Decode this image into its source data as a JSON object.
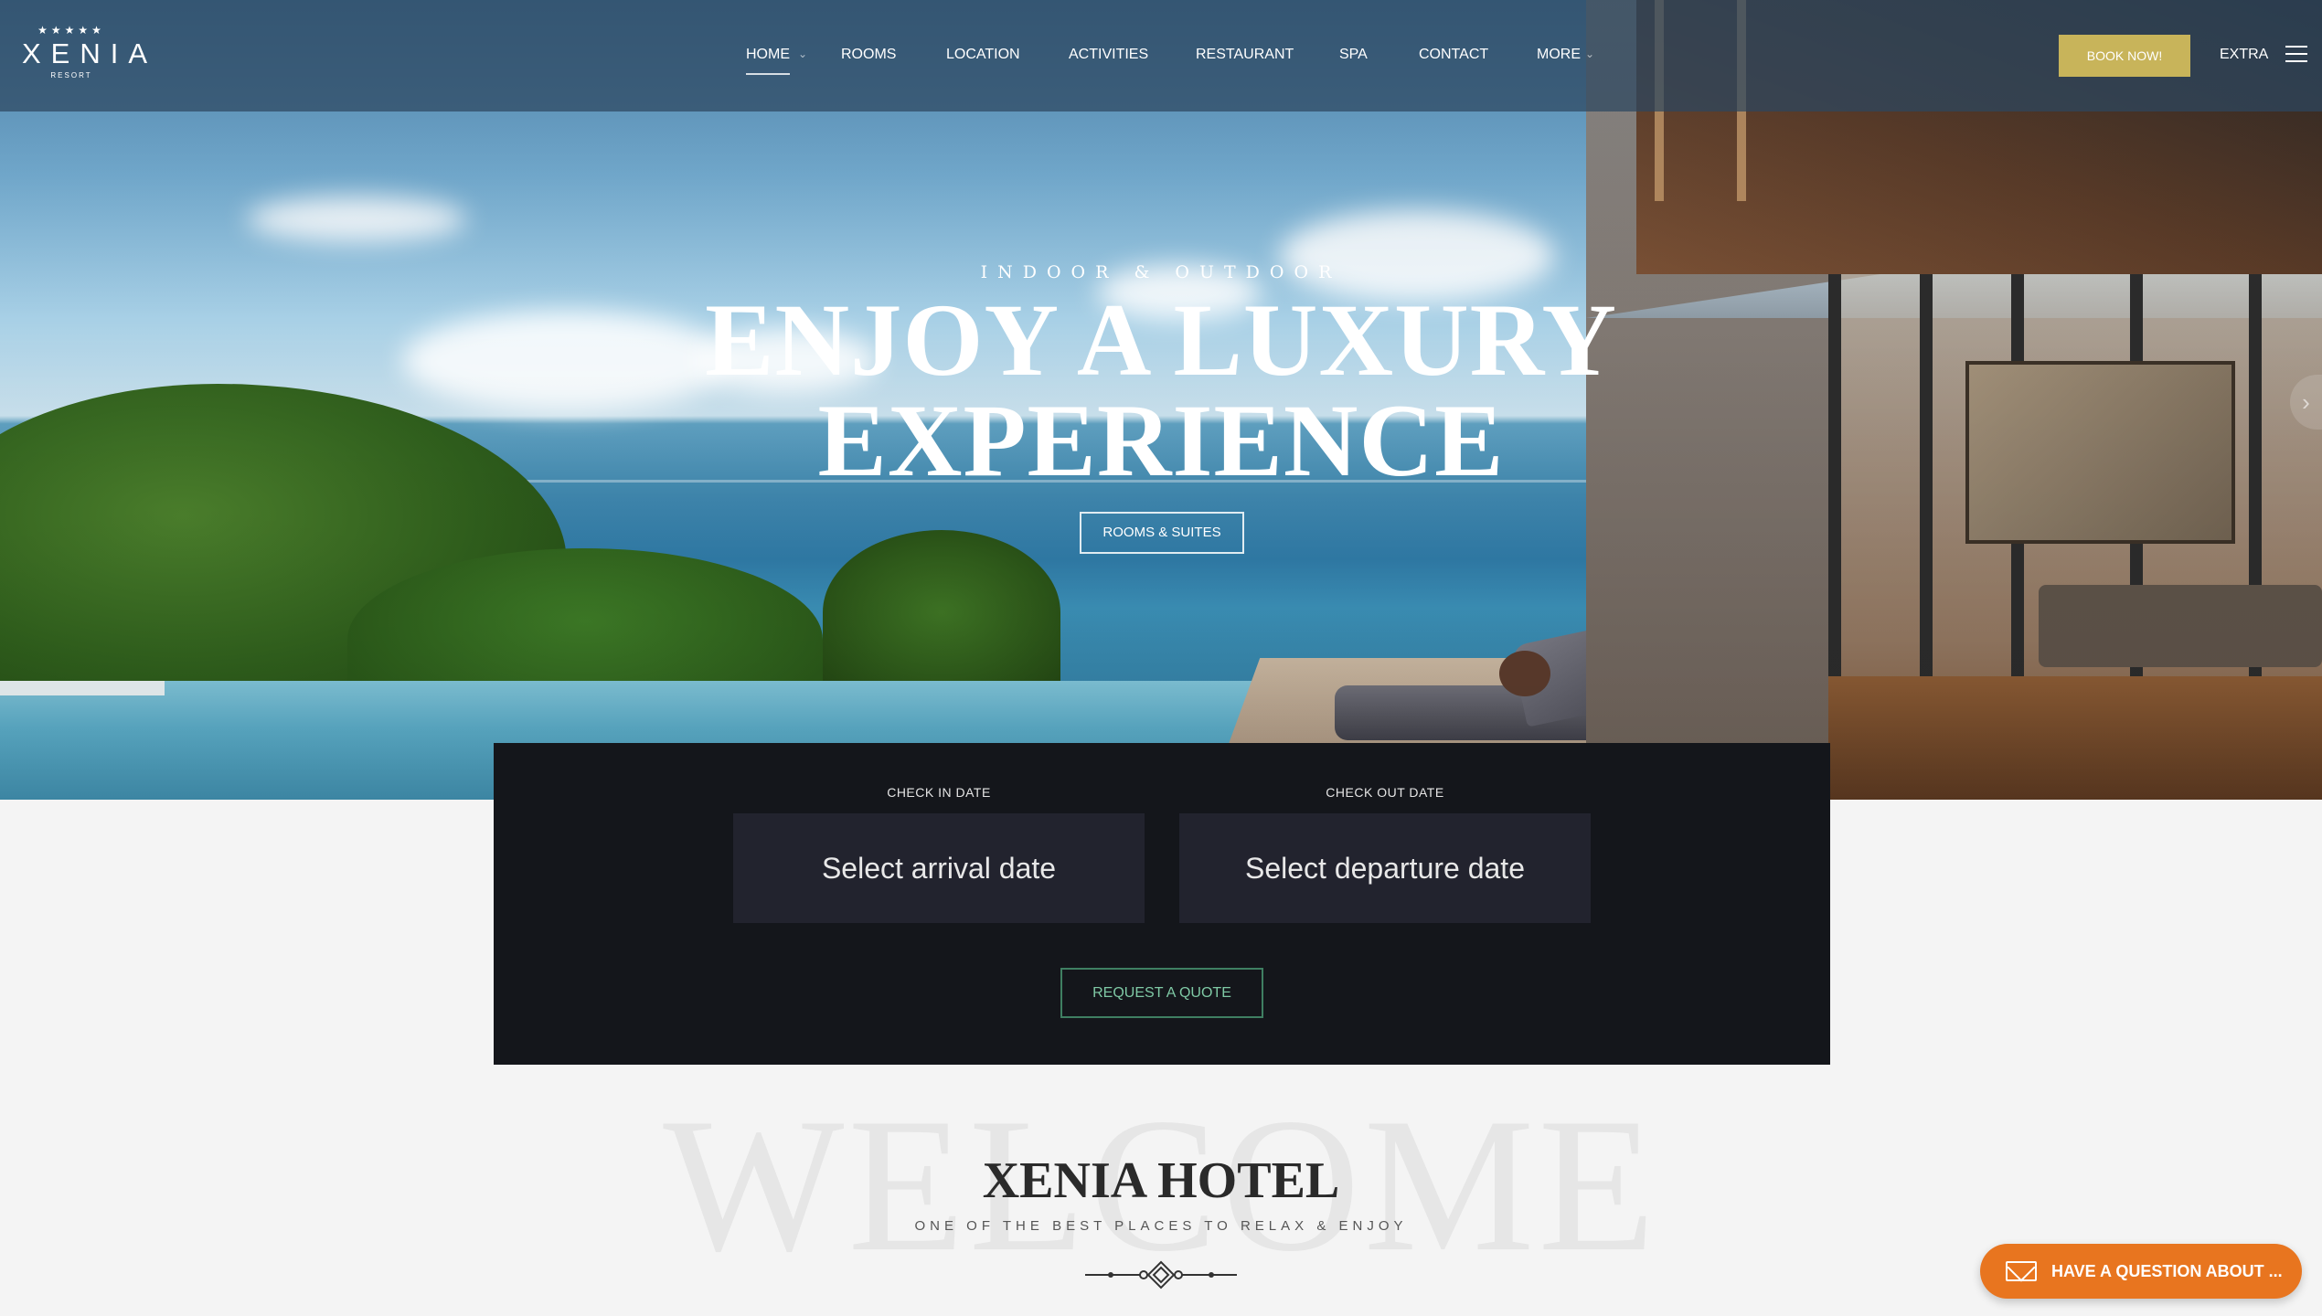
{
  "header": {
    "logo": {
      "stars": "★★★★★",
      "name": "XENIA",
      "sub": "RESORT"
    },
    "nav": [
      {
        "label": "HOME",
        "active": true,
        "has_dropdown": true
      },
      {
        "label": "ROOMS"
      },
      {
        "label": "LOCATION"
      },
      {
        "label": "ACTIVITIES"
      },
      {
        "label": "RESTAURANT"
      },
      {
        "label": "SPA"
      },
      {
        "label": "CONTACT"
      },
      {
        "label": "MORE",
        "has_dropdown": true
      }
    ],
    "book_button": "BOOK NOW!",
    "extra_label": "EXTRA",
    "menu_icon": "hamburger-menu-icon"
  },
  "hero": {
    "eyebrow": "INDOOR & OUTDOOR",
    "title_line1": "ENJOY A LUXURY",
    "title_line2": "EXPERIENCE",
    "button": "ROOMS & SUITES",
    "next_arrow": "›"
  },
  "booking": {
    "checkin_label": "CHECK IN DATE",
    "checkin_placeholder": "Select arrival date",
    "checkout_label": "CHECK OUT DATE",
    "checkout_placeholder": "Select departure date",
    "quote_button": "REQUEST A QUOTE"
  },
  "welcome": {
    "ghost": "WELCOME",
    "title": "XENIA HOTEL",
    "subtitle": "ONE OF THE BEST PLACES TO RELAX & ENJOY"
  },
  "chat": {
    "icon": "envelope-icon",
    "label": "HAVE A QUESTION ABOUT ..."
  },
  "colors": {
    "book_button": "#c8b45a",
    "booking_panel": "#14161b",
    "booking_field": "#22232e",
    "quote_accent": "#3f7f62",
    "chat_button": "#e8751f"
  }
}
